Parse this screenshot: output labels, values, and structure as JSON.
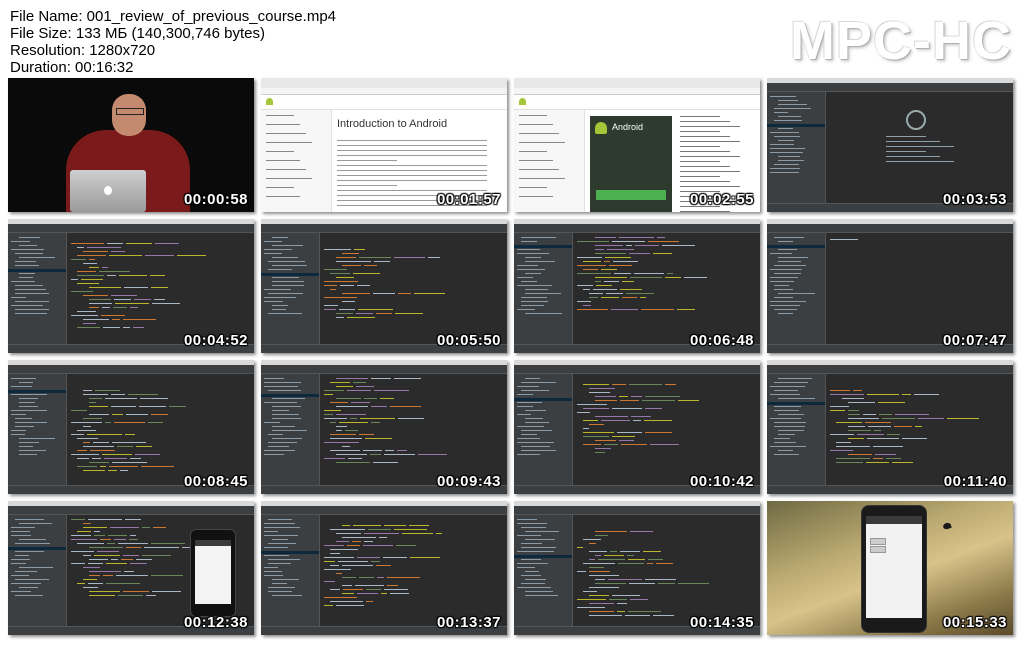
{
  "header": {
    "file_name": "File Name: 001_review_of_previous_course.mp4",
    "file_size": "File Size: 133 МБ (140,300,746 bytes)",
    "resolution": "Resolution: 1280x720",
    "duration": "Duration: 00:16:32"
  },
  "brand": {
    "label": "MPC-HC"
  },
  "thumbnails": [
    {
      "time": "00:00:58",
      "scene": "camera"
    },
    {
      "time": "00:01:57",
      "scene": "browser-docs"
    },
    {
      "time": "00:02:55",
      "scene": "browser-studio"
    },
    {
      "time": "00:03:53",
      "scene": "ide-welcome"
    },
    {
      "time": "00:04:52",
      "scene": "ide-code"
    },
    {
      "time": "00:05:50",
      "scene": "ide-code"
    },
    {
      "time": "00:06:48",
      "scene": "ide-code"
    },
    {
      "time": "00:07:47",
      "scene": "ide-empty"
    },
    {
      "time": "00:08:45",
      "scene": "ide-code"
    },
    {
      "time": "00:09:43",
      "scene": "ide-code"
    },
    {
      "time": "00:10:42",
      "scene": "ide-code"
    },
    {
      "time": "00:11:40",
      "scene": "ide-code"
    },
    {
      "time": "00:12:38",
      "scene": "ide-phone"
    },
    {
      "time": "00:13:37",
      "scene": "ide-code"
    },
    {
      "time": "00:14:35",
      "scene": "ide-code"
    },
    {
      "time": "00:15:33",
      "scene": "emulator"
    }
  ],
  "browser_docs": {
    "heading": "Introduction to Android"
  },
  "browser_studio": {
    "logo_text": "Android"
  },
  "colors": {
    "ide_bg": "#2b2b2b",
    "ide_panel": "#3c3f41",
    "code_orange": "#cc7832",
    "code_green": "#6a8759",
    "code_purple": "#9876aa",
    "code_yellow": "#bbb529",
    "code_text": "#a9b7c6",
    "android_green": "#a4c639",
    "timestamp": "#ffffff"
  }
}
